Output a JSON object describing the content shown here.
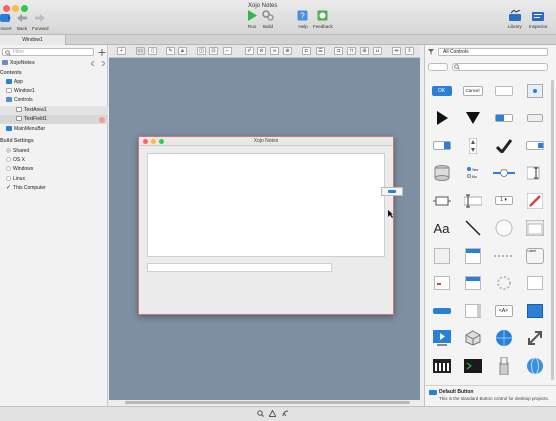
{
  "window": {
    "title": "Xojo Notes"
  },
  "toolbar": {
    "insert": "Insert",
    "back": "Back",
    "forward": "Forward",
    "run": "Run",
    "build": "Build",
    "help": "Help",
    "feedback": "Feedback",
    "library": "Library",
    "inspector": "Inspector"
  },
  "tabs": [
    {
      "label": "Window1"
    }
  ],
  "navigator": {
    "search_placeholder": "Filter",
    "project": "XojoNotes",
    "contents_header": "Contents",
    "items": [
      "App",
      "Window1",
      "Controls",
      "TextArea1",
      "TextField1",
      "MainMenuBar"
    ],
    "build_header": "Build Settings",
    "build_items": [
      "Shared",
      "OS X",
      "Windows",
      "Linux",
      "This Computer"
    ]
  },
  "designer": {
    "window_title": "Xojo Notes"
  },
  "library": {
    "filter_value": "All Controls",
    "ok_label": "OK",
    "cancel_label": "Cancel",
    "label_text": "Label",
    "canvas_text": "Aa",
    "yes_label": "Yes",
    "no_label": "No",
    "html_label": "<A>",
    "desc_title": "Default Button",
    "desc_body": "This is the standard Button control for desktop projects."
  },
  "colors": {
    "canvas": "#7d8fa0",
    "accent": "#2a7fd6",
    "selection": "#e6e6e6"
  }
}
